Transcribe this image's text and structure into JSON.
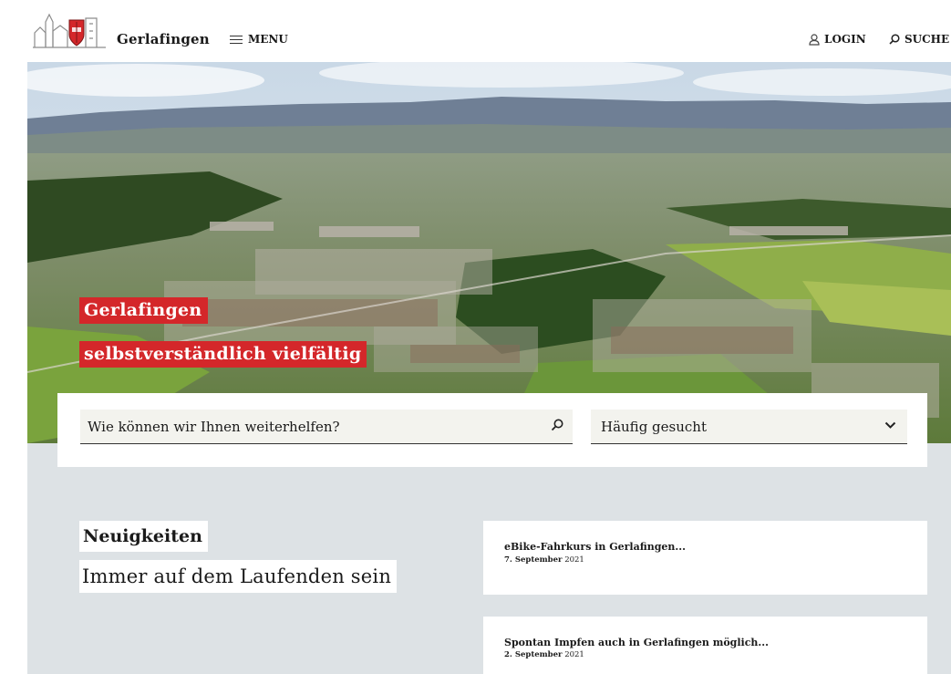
{
  "header": {
    "brand": "Gerlafingen",
    "menu_label": "MENU",
    "login_label": "LOGIN",
    "search_label": "SUCHE"
  },
  "hero": {
    "tagline_1": "Gerlafingen",
    "tagline_2": "selbstverständlich vielfältig"
  },
  "search": {
    "placeholder": "Wie können wir Ihnen weiterhelfen?",
    "frequent_select_value": "Häufig gesucht"
  },
  "news": {
    "title": "Neuigkeiten",
    "subtitle": "Immer auf dem Laufenden sein",
    "items": [
      {
        "title": "eBike-Fahrkurs in Gerlafingen...",
        "date_day": "7. September",
        "date_year": "2021"
      },
      {
        "title": "Spontan Impfen auch in Gerlafingen möglich...",
        "date_day": "2. September",
        "date_year": "2021"
      }
    ]
  },
  "colors": {
    "accent_red": "#d4272a",
    "news_background": "#dde2e5",
    "field_background": "#f3f3ee"
  },
  "icons": {
    "menu": "hamburger-icon",
    "login": "user-icon",
    "search": "search-icon",
    "select": "chevron-down-icon"
  }
}
